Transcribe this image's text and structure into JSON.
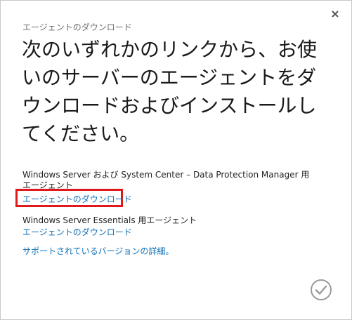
{
  "dialog": {
    "subtitle": "エージェントのダウンロード",
    "heading": "次のいずれかのリンクから、お使いのサーバーのエージェントをダウンロードおよびインストールしてください。",
    "dpm_label": "Windows Server および System Center – Data Protection Manager 用エージェント",
    "dpm_link": "エージェントのダウンロード",
    "essentials_label": "Windows Server Essentials 用エージェント",
    "essentials_link": "エージェントのダウンロード",
    "versions_link": "サポートされているバージョンの詳細。"
  },
  "colors": {
    "link": "#0c6fb7",
    "highlight": "#e01a1a"
  },
  "icons": {
    "close": "close-icon",
    "ok": "check-circle-icon"
  }
}
